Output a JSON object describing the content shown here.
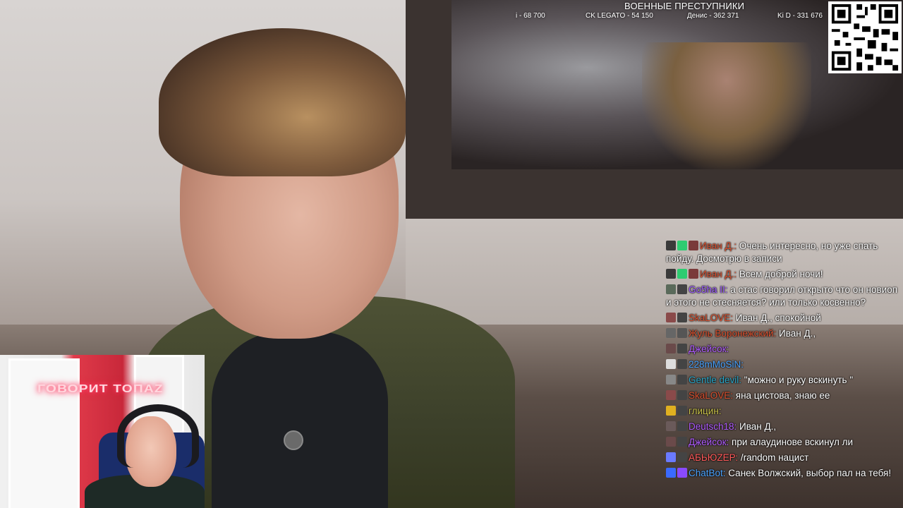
{
  "overlay": {
    "title": "ВОЕННЫЕ ПРЕСТУПНИКИ",
    "stats": [
      {
        "label": "i - 68 700"
      },
      {
        "label": "CK LEGATO - 54 150"
      },
      {
        "label": "Денис - 362 371"
      },
      {
        "label": "Ki D - 331 676"
      }
    ]
  },
  "cam": {
    "neon_sign": "ГОВОРИТ ТОПАZ"
  },
  "chat": {
    "messages": [
      {
        "nick": "Иван Д.:",
        "color": "#d9502f",
        "text": "Очень интересно, но уже спать пойду. Досмотрю в записи",
        "badges": [
          "#3a3a3a",
          "#2ecc71",
          "#7a3a3a"
        ]
      },
      {
        "nick": "Иван Д.:",
        "color": "#d9502f",
        "text": "Всем доброй ночи!",
        "badges": [
          "#3a3a3a",
          "#2ecc71",
          "#7a3a3a"
        ]
      },
      {
        "nick": "Go5ha II:",
        "color": "#9b59ff",
        "text": "а стас говорил открыто что он новиоп и этого не стесняется? или только косвенно?",
        "badges": [
          "#5a6a5a",
          "#444"
        ]
      },
      {
        "nick": "SkaLOVE:",
        "color": "#d9502f",
        "text": "Иван Д.,  спокойной",
        "badges": [
          "#8a4a4a",
          "#444"
        ]
      },
      {
        "nick": "Жуль Воронежский:",
        "color": "#d9502f",
        "text": "Иван Д.,",
        "badges": [
          "#666",
          "#555"
        ]
      },
      {
        "nick": "Джейсок:",
        "color": "#b05cff",
        "text": "",
        "badges": [
          "#6a4a4a",
          "#444"
        ]
      },
      {
        "nick": "228mMoSiN:",
        "color": "#4aa3ff",
        "text": "",
        "badges": [
          "#ddd",
          "#444"
        ]
      },
      {
        "nick": "Gentle devil:",
        "color": "#2aa7c9",
        "text": "\"можно и руку вскинуть \"",
        "badges": [
          "#888",
          "#444"
        ]
      },
      {
        "nick": "SkaLOVE:",
        "color": "#d9502f",
        "text": "яна цистова, знаю ее",
        "badges": [
          "#8a4a4a",
          "#444"
        ]
      },
      {
        "nick": "глицин:",
        "color": "#c9c24a",
        "text": "",
        "badges": [
          "#e0b020",
          "#444"
        ]
      },
      {
        "nick": "Deutsch18:",
        "color": "#b05cff",
        "text": "Иван Д.,",
        "badges": [
          "#6a5a5a",
          "#444"
        ]
      },
      {
        "nick": "Джейсок:",
        "color": "#b05cff",
        "text": "при алаудинове вскинул ли",
        "badges": [
          "#6a4a4a",
          "#444"
        ]
      },
      {
        "nick": "АБЬЮZЕР:",
        "color": "#ff5a5a",
        "text": "/random нацист",
        "badges": [
          "#6a7aff",
          "#444"
        ]
      },
      {
        "nick": "ChatBot:",
        "color": "#4aa3ff",
        "text": "Санек Волжский, выбор пал на тебя!",
        "badges": [
          "#3a6aff",
          "#8a4aff"
        ]
      }
    ]
  }
}
